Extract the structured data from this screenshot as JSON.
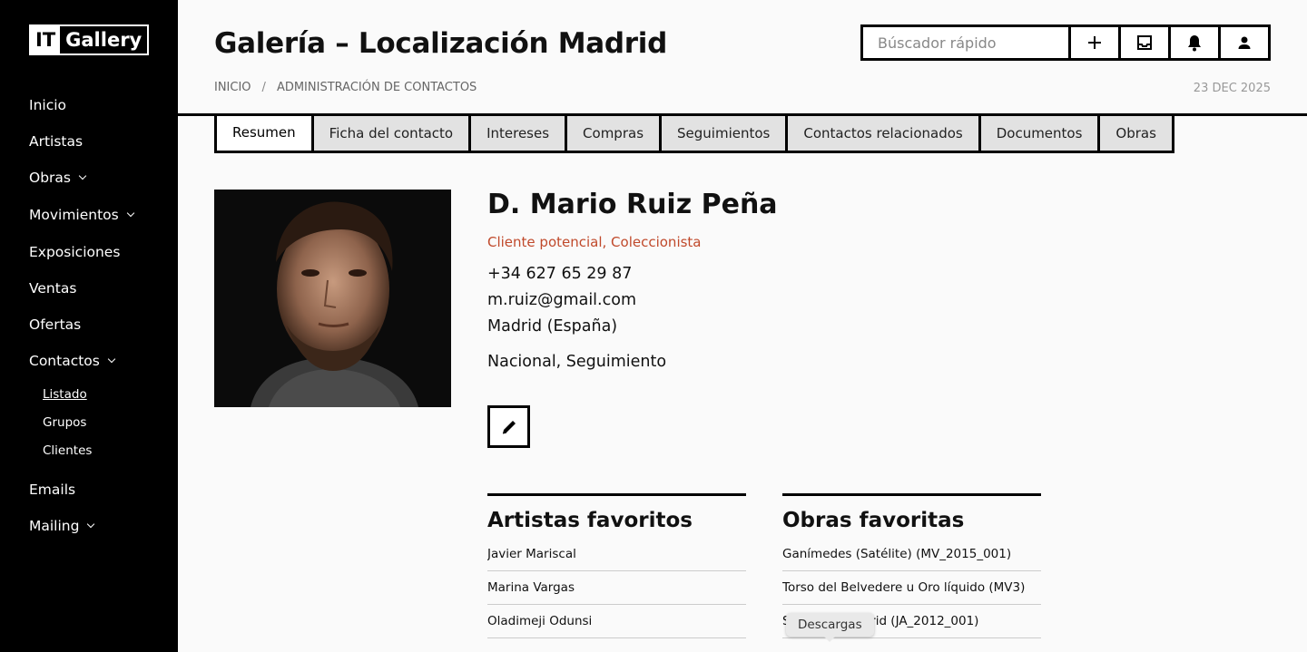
{
  "app": {
    "logo_it": "IT",
    "logo_gallery": "Gallery"
  },
  "sidebar": {
    "items": [
      {
        "label": "Inicio"
      },
      {
        "label": "Artistas"
      },
      {
        "label": "Obras"
      },
      {
        "label": "Movimientos"
      },
      {
        "label": "Exposiciones"
      },
      {
        "label": "Ventas"
      },
      {
        "label": "Ofertas"
      },
      {
        "label": "Contactos"
      },
      {
        "label": "Emails"
      },
      {
        "label": "Mailing"
      }
    ],
    "contactos_sub": [
      {
        "label": "Listado"
      },
      {
        "label": "Grupos"
      },
      {
        "label": "Clientes"
      }
    ]
  },
  "header": {
    "title": "Galería – Localización Madrid",
    "breadcrumb": [
      "INICIO",
      "ADMINISTRACIÓN DE CONTACTOS"
    ],
    "breadcrumb_sep": "/",
    "date": "23 DEC 2025",
    "search_placeholder": "Búscador rápido"
  },
  "tabs": [
    {
      "label": "Resumen",
      "active": true
    },
    {
      "label": "Ficha del contacto"
    },
    {
      "label": "Intereses"
    },
    {
      "label": "Compras"
    },
    {
      "label": "Seguimientos"
    },
    {
      "label": "Contactos relacionados"
    },
    {
      "label": "Documentos"
    },
    {
      "label": "Obras"
    }
  ],
  "contact": {
    "name": "D. Mario Ruiz Peña",
    "type": "Cliente potencial, Coleccionista",
    "phone": "+34 627 65 29 87",
    "email": "m.ruiz@gmail.com",
    "location": "Madrid (España)",
    "tags": "Nacional, Seguimiento"
  },
  "favorite_artists": {
    "title": "Artistas favoritos",
    "items": [
      "Javier Mariscal",
      "Marina Vargas",
      "Oladimeji Odunsi"
    ]
  },
  "favorite_works": {
    "title": "Obras favoritas",
    "items": [
      "Ganímedes (Satélite) (MV_2015_001)",
      "Torso del Belvedere u Oro líquido (MV3)",
      "Sin título, Madrid (JA_2012_001)"
    ]
  },
  "tooltip": {
    "label": "Descargas"
  },
  "colors": {
    "sidebar_bg": "#000000",
    "accent_red": "#c0492b",
    "tab_inactive": "#e2e2e2"
  }
}
